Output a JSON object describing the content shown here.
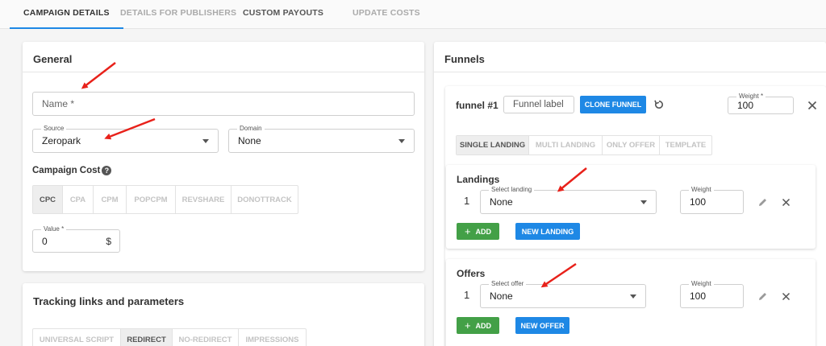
{
  "tabs": [
    {
      "label": "CAMPAIGN DETAILS",
      "active": true
    },
    {
      "label": "DETAILS FOR PUBLISHERS"
    },
    {
      "label": "CUSTOM PAYOUTS"
    },
    {
      "label": "UPDATE COSTS"
    }
  ],
  "general": {
    "title": "General",
    "name_placeholder": "Name *",
    "source": {
      "label": "Source",
      "value": "Zeropark"
    },
    "domain": {
      "label": "Domain",
      "value": "None"
    },
    "campaign_cost_label": "Campaign Cost",
    "cost_types": [
      "CPC",
      "CPA",
      "CPM",
      "POPCPM",
      "REVSHARE",
      "DONOTTRACK"
    ],
    "value_field": {
      "label": "Value *",
      "value": "0",
      "suffix": "$"
    }
  },
  "tracking": {
    "title": "Tracking links and parameters",
    "modes": [
      "UNIVERSAL SCRIPT",
      "REDIRECT",
      "NO-REDIRECT",
      "IMPRESSIONS"
    ]
  },
  "funnels": {
    "title": "Funnels",
    "funnel_name": "funnel #1",
    "funnel_label_placeholder": "Funnel label",
    "clone_label": "CLONE FUNNEL",
    "weight": {
      "label": "Weight *",
      "value": "100"
    },
    "modes": [
      "SINGLE LANDING",
      "MULTI LANDING",
      "ONLY OFFER",
      "TEMPLATE"
    ],
    "landings": {
      "title": "Landings",
      "row_number": "1",
      "select": {
        "label": "Select landing",
        "value": "None"
      },
      "weight": {
        "label": "Weight",
        "value": "100"
      },
      "add_label": "ADD",
      "new_label": "NEW LANDING"
    },
    "offers": {
      "title": "Offers",
      "row_number": "1",
      "select": {
        "label": "Select offer",
        "value": "None"
      },
      "weight": {
        "label": "Weight",
        "value": "100"
      },
      "add_label": "ADD",
      "new_label": "NEW OFFER"
    }
  },
  "colors": {
    "accent": "#1e88e5",
    "success": "#43a047",
    "annotation": "#e8211a"
  }
}
